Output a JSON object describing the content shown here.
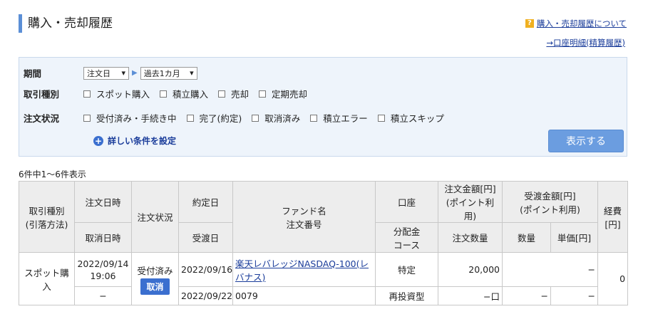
{
  "header": {
    "title": "購入・売却履歴",
    "help_label": "購入・売却履歴について",
    "account_link": "→口座明細(精算履歴)"
  },
  "filter": {
    "period_label": "期間",
    "period_type": "注文日",
    "period_range": "過去1カ月",
    "txn_label": "取引種別",
    "txn_options": [
      "スポット購入",
      "積立購入",
      "売却",
      "定期売却"
    ],
    "status_label": "注文状況",
    "status_options": [
      "受付済み・手続き中",
      "完了(約定)",
      "取消済み",
      "積立エラー",
      "積立スキップ"
    ],
    "detail_label": "詳しい条件を設定",
    "show_button": "表示する"
  },
  "result_count": "6件中1〜6件表示",
  "table": {
    "headers": {
      "type": "取引種別\n(引落方法)",
      "order_date": "注文日時",
      "cancel_date": "取消日時",
      "status": "注文状況",
      "exec_date": "約定日",
      "delivery_date": "受渡日",
      "fund": "ファンド名\n注文番号",
      "account": "口座",
      "dist": "分配金\nコース",
      "order_amount": "注文金額[円]\n(ポイント利用)",
      "order_qty": "注文数量",
      "settle_amount": "受渡金額[円]\n(ポイント利用)",
      "qty": "数量",
      "unit_price": "単価[円]",
      "fee": "経費\n[円]"
    },
    "rows": [
      {
        "type": "スポット購入",
        "order_date": "2022/09/14\n19:06",
        "cancel_date": "−",
        "status": "受付済み",
        "cancel_button": "取消",
        "exec_date": "2022/09/16",
        "delivery_date": "2022/09/22",
        "fund_name": "楽天レバレッジNASDAQ-100(レバナス)",
        "order_no": "0079",
        "account": "特定",
        "dist": "再投資型",
        "order_amount": "20,000",
        "order_qty": "−口",
        "settle_amount": "−",
        "qty": "−",
        "unit_price": "−",
        "fee": "0"
      }
    ]
  }
}
